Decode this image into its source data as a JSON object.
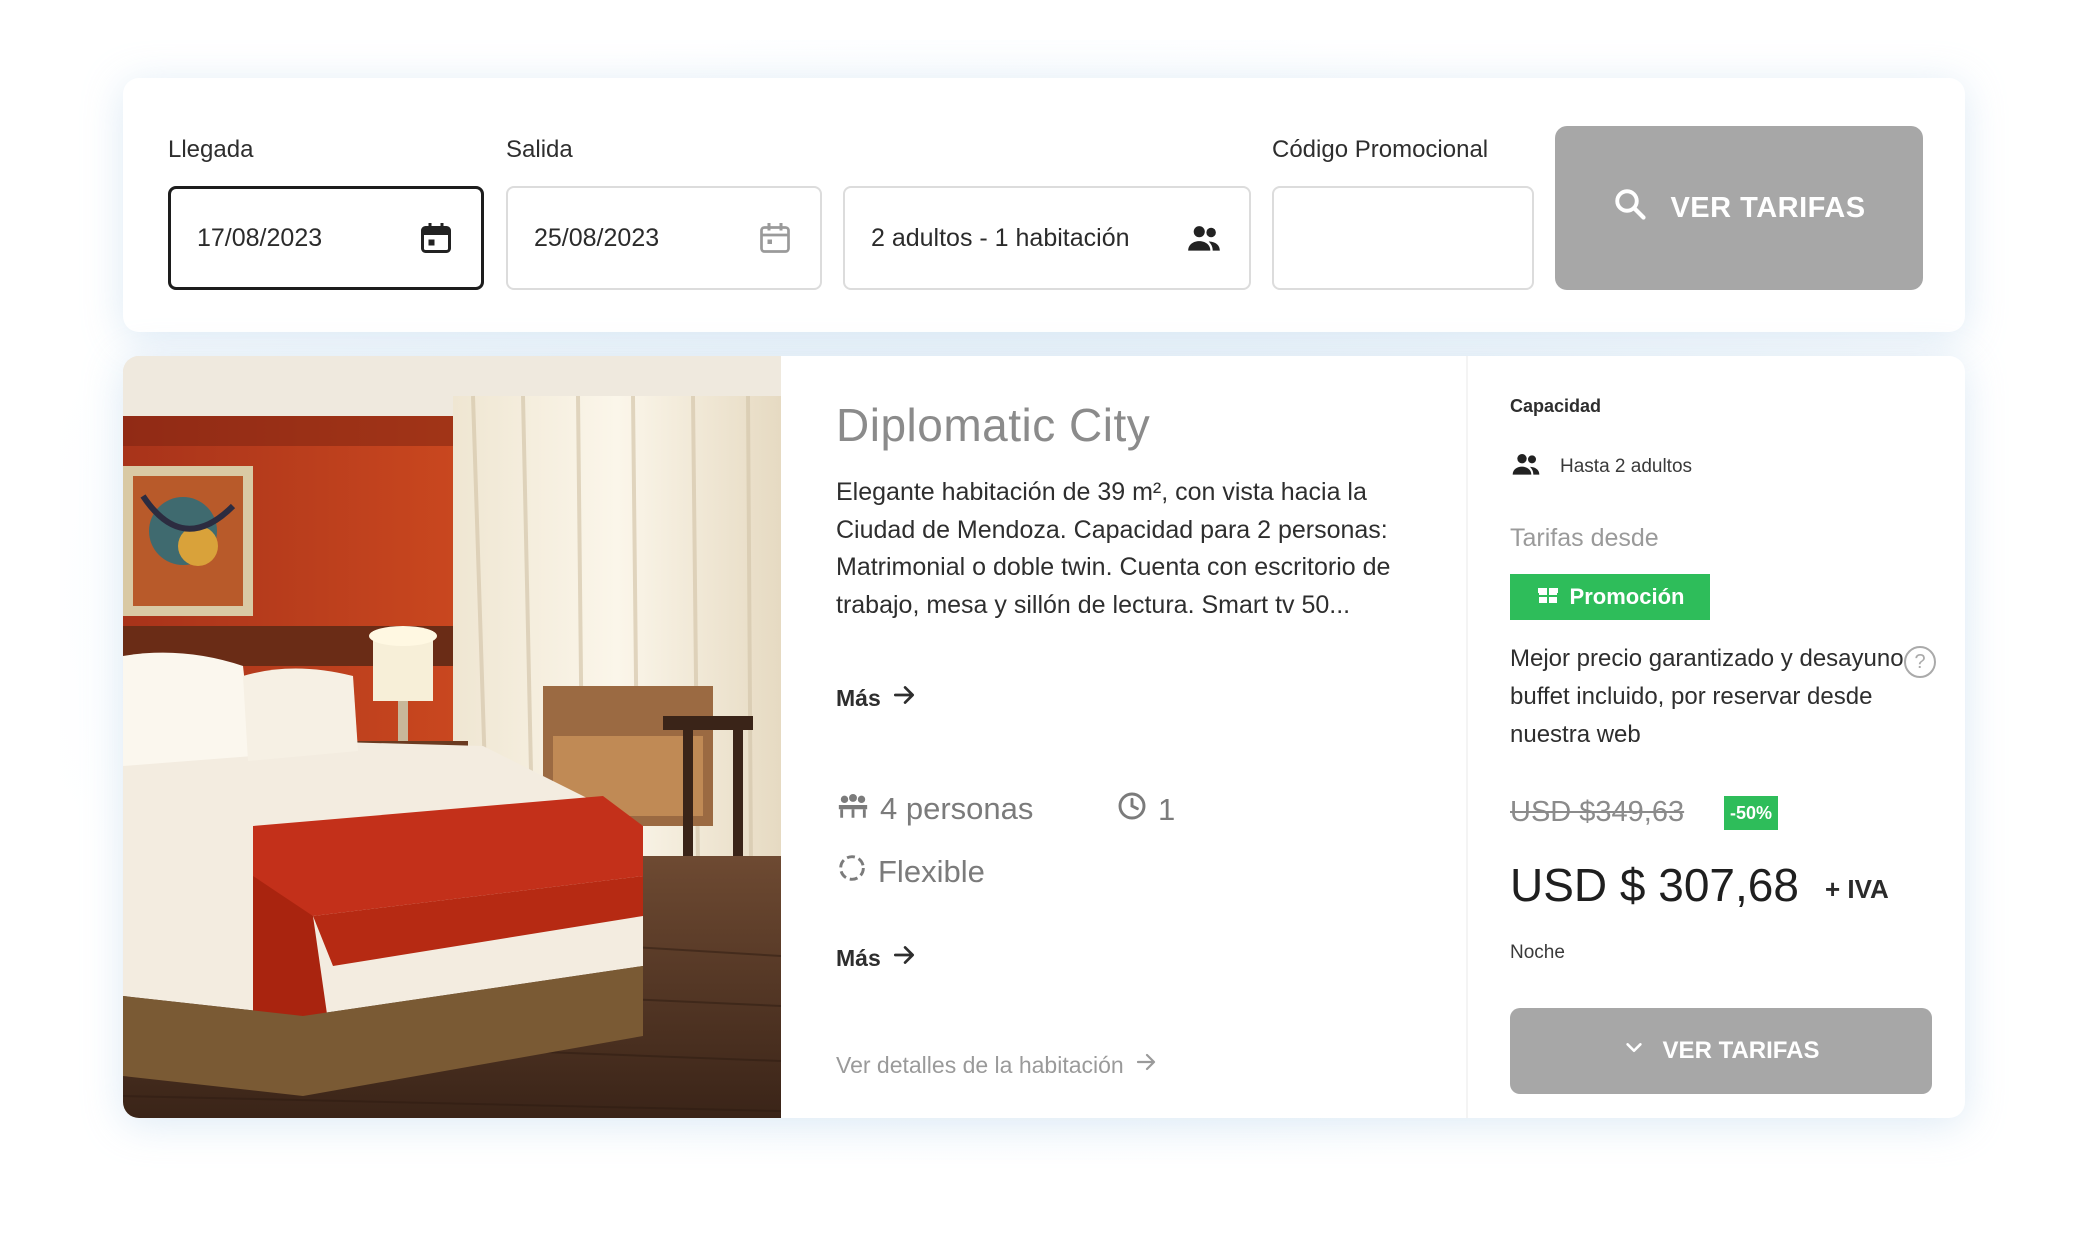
{
  "search": {
    "arrival_label": "Llegada",
    "arrival_value": "17/08/2023",
    "departure_label": "Salida",
    "departure_value": "25/08/2023",
    "guests_value": "2 adultos - 1 habitación",
    "promo_label": "Código Promocional",
    "promo_value": "",
    "button_label": "VER TARIFAS"
  },
  "room": {
    "name": "Diplomatic City",
    "description": "Elegante habitación de 39 m², con vista hacia la Ciudad de Mendoza. Capacidad para 2 personas: Matrimonial o doble twin. Cuenta con escritorio de trabajo, mesa y sillón de lectura. Smart tv 50...",
    "more_label": "Más",
    "persons": "4 personas",
    "count": "1",
    "policy": "Flexible",
    "more_label_2": "Más",
    "details_link": "Ver detalles de la habitación"
  },
  "rate": {
    "capacity_label": "Capacidad",
    "capacity_value": "Hasta 2 adultos",
    "rates_from_label": "Tarifas desde",
    "promo_badge": "Promoción",
    "promo_desc": "Mejor precio garantizado y desayuno buffet incluido, por reservar desde nuestra web",
    "help": "?",
    "old_price": "USD $349,63",
    "discount": "-50%",
    "price": "USD $ 307,68",
    "tax": "+ IVA",
    "per": "Noche",
    "button_label": "VER TARIFAS"
  },
  "colors": {
    "button_gray": "#a7a7a7",
    "promo_green": "#2ebd5a",
    "title_gray": "#8b8b8b"
  },
  "icons": {
    "arrival": "calendar-icon",
    "departure": "calendar-icon",
    "guests": "people-icon",
    "search": "search-icon",
    "persons": "group-icon",
    "count": "clock-icon",
    "policy": "refresh-icon",
    "more": "arrow-right-icon",
    "promo": "gift-icon",
    "rates": "chevron-down-icon"
  }
}
